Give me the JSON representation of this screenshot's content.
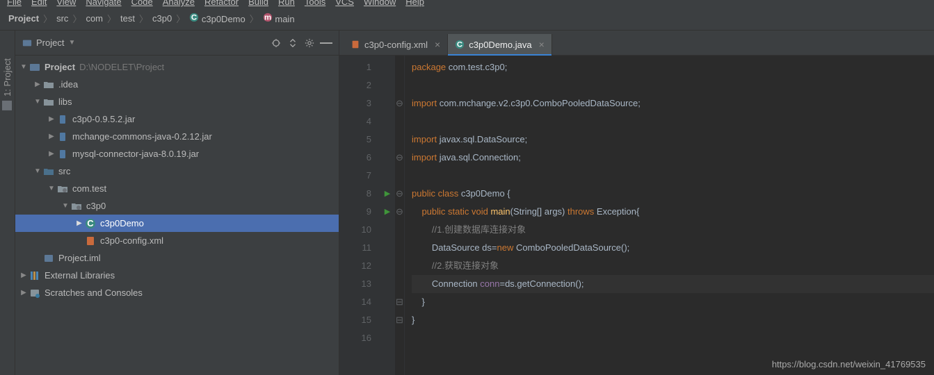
{
  "menu": [
    "File",
    "Edit",
    "View",
    "Navigate",
    "Code",
    "Analyze",
    "Refactor",
    "Build",
    "Run",
    "Tools",
    "VCS",
    "Window",
    "Help"
  ],
  "breadcrumbs": {
    "items": [
      "Project",
      "src",
      "com",
      "test",
      "c3p0",
      "c3p0Demo",
      "main"
    ]
  },
  "project_panel": {
    "title": "Project"
  },
  "tree": {
    "root": {
      "label": "Project",
      "path": "D:\\NODELET\\Project"
    },
    "idea": ".idea",
    "libs": "libs",
    "jar1": "c3p0-0.9.5.2.jar",
    "jar2": "mchange-commons-java-0.2.12.jar",
    "jar3": "mysql-connector-java-8.0.19.jar",
    "src": "src",
    "pkg": "com.test",
    "subpkg": "c3p0",
    "javafile": "c3p0Demo",
    "xmlfile": "c3p0-config.xml",
    "iml": "Project.iml",
    "ext": "External Libraries",
    "scratch": "Scratches and Consoles"
  },
  "tabs": {
    "t1": "c3p0-config.xml",
    "t2": "c3p0Demo.java"
  },
  "code": {
    "l1a": "package ",
    "l1b": "com.test.c3p0",
    "l3a": "import ",
    "l3b": "com.mchange.v2.c3p0.ComboPooledDataSource",
    "l5a": "import ",
    "l5b": "javax.sql.DataSource",
    "l6a": "import ",
    "l6b": "java.sql.Connection",
    "l8a": "public class ",
    "l8b": "c3p0Demo",
    "l8c": " {",
    "l9a": "    public static void ",
    "l9b": "main",
    "l9c": "(String[] args) ",
    "l9d": "throws ",
    "l9e": "Exception{",
    "l10": "        //1.创建数据库连接对象",
    "l11a": "        DataSource ds=",
    "l11b": "new ",
    "l11c": "ComboPooledDataSource();",
    "l12": "        //2.获取连接对象",
    "l13a": "        Connection ",
    "l13b": "conn",
    "l13c": "=ds.getConnection();",
    "l14": "    }",
    "l15": "}"
  },
  "gutter": [
    "1",
    "2",
    "3",
    "4",
    "5",
    "6",
    "7",
    "8",
    "9",
    "10",
    "11",
    "12",
    "13",
    "14",
    "15",
    "16"
  ],
  "watermark": "https://blog.csdn.net/weixin_41769535"
}
